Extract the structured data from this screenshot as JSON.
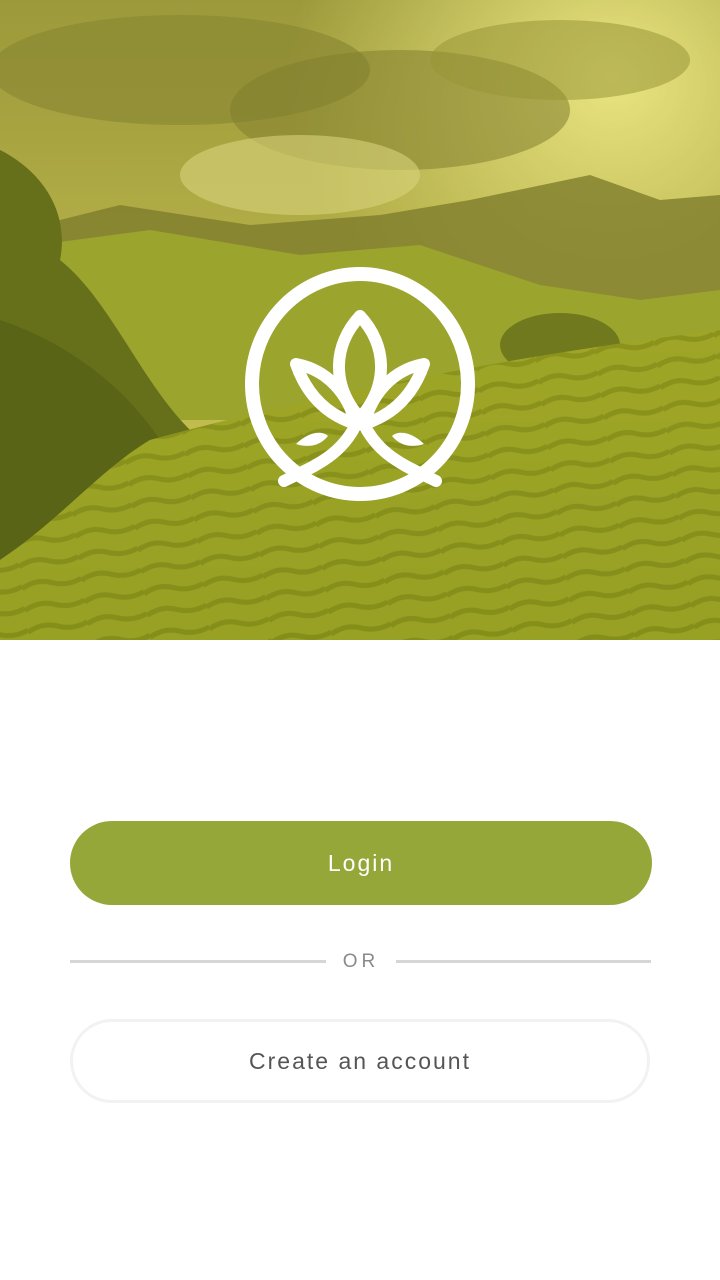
{
  "hero": {
    "background_image": "tea-plantation-hills",
    "tint_color": "#c8c832",
    "logo_icon": "lotus-leaf-logo-icon"
  },
  "actions": {
    "login_label": "Login",
    "divider_label": "OR",
    "create_account_label": "Create an account"
  },
  "colors": {
    "accent": "#96a73a",
    "divider": "#d6d6d6",
    "secondary_text": "#555555"
  }
}
